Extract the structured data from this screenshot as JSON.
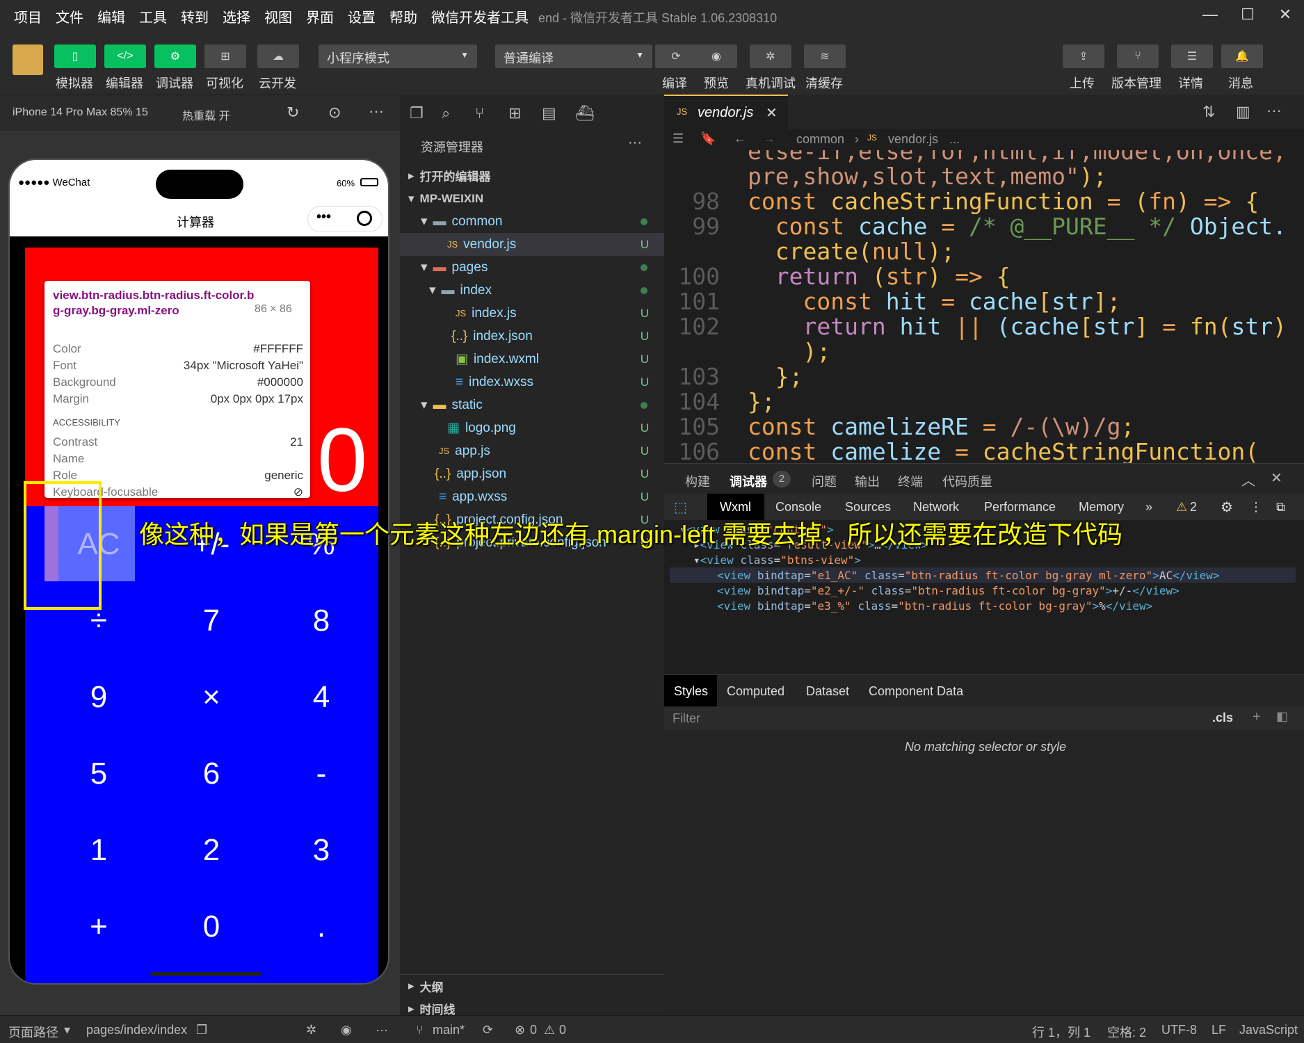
{
  "menu": [
    "项目",
    "文件",
    "编辑",
    "工具",
    "转到",
    "选择",
    "视图",
    "界面",
    "设置",
    "帮助",
    "微信开发者工具"
  ],
  "window_title": "end - 微信开发者工具 Stable 1.06.2308310",
  "toolbar": {
    "simulator": "模拟器",
    "editor": "编辑器",
    "debugger": "调试器",
    "visual": "可视化",
    "cloud": "云开发",
    "mode": "小程序模式",
    "compile_mode": "普通编译",
    "compile": "编译",
    "preview": "预览",
    "real_debug": "真机调试",
    "clear_cache": "清缓存",
    "upload": "上传",
    "version": "版本管理",
    "details": "详情",
    "messages": "消息"
  },
  "sim": {
    "device": "iPhone 14 Pro Max 85% 15",
    "hotreload": "热重载 开",
    "carrier": "●●●●● WeChat",
    "battery": "60%",
    "nav_title": "计算器",
    "display": "0"
  },
  "tooltip": {
    "selector": "view.btn-radius.btn-radius.ft-color.bg-gray.bg-gray.ml-zero",
    "size": "86 × 86",
    "color_label": "Color",
    "color_value": "#FFFFFF",
    "font_label": "Font",
    "font_value": "34px \"Microsoft YaHei\"",
    "bg_label": "Background",
    "bg_value": "#000000",
    "margin_label": "Margin",
    "margin_value": "0px 0px 0px 17px",
    "access": "ACCESSIBILITY",
    "contrast_label": "Contrast",
    "contrast_value": "21",
    "name_label": "Name",
    "role_label": "Role",
    "role_value": "generic",
    "kbd_label": "Keyboard-focusable"
  },
  "keys": [
    [
      "AC",
      "+/-",
      "%"
    ],
    [
      "÷",
      "7",
      "8"
    ],
    [
      "9",
      "×",
      "4"
    ],
    [
      "5",
      "6",
      "-"
    ],
    [
      "1",
      "2",
      "3"
    ],
    [
      "+",
      "0",
      "."
    ]
  ],
  "explorer": {
    "title": "资源管理器",
    "open_editors": "打开的编辑器",
    "root": "MP-WEIXIN",
    "items": [
      {
        "name": "common",
        "status": ""
      },
      {
        "name": "vendor.js",
        "status": "U"
      },
      {
        "name": "pages",
        "status": ""
      },
      {
        "name": "index",
        "status": ""
      },
      {
        "name": "index.js",
        "status": "U"
      },
      {
        "name": "index.json",
        "status": "U"
      },
      {
        "name": "index.wxml",
        "status": "U"
      },
      {
        "name": "index.wxss",
        "status": "U"
      },
      {
        "name": "static",
        "status": ""
      },
      {
        "name": "logo.png",
        "status": "U"
      },
      {
        "name": "app.js",
        "status": "U"
      },
      {
        "name": "app.json",
        "status": "U"
      },
      {
        "name": "app.wxss",
        "status": "U"
      },
      {
        "name": "project.config.json",
        "status": "U"
      },
      {
        "name": "project.private.config.json",
        "status": "U"
      }
    ],
    "outline": "大纲",
    "timeline": "时间线"
  },
  "editor": {
    "tab": "vendor.js",
    "crumb1": "common",
    "crumb2": "vendor.js",
    "crumb3": "..."
  },
  "code": {
    "ln98": "98",
    "ln99": "99",
    "ln100": "100",
    "ln101": "101",
    "ln102": "102",
    "ln103": "103",
    "ln104": "104",
    "ln105": "105",
    "ln106": "106"
  },
  "devtools": {
    "tabs": [
      "构建",
      "调试器",
      "问题",
      "输出",
      "终端",
      "代码质量"
    ],
    "badge": "2",
    "panels": [
      "Wxml",
      "Console",
      "Sources",
      "Network",
      "Performance",
      "Memory"
    ],
    "warn": "2",
    "style_tabs": [
      "Styles",
      "Computed",
      "Dataset",
      "Component Data"
    ],
    "filter": "Filter",
    "cls": ".cls",
    "empty": "No matching selector or style"
  },
  "statusbar": {
    "path_label": "页面路径",
    "path": "pages/index/index",
    "branch": "main*",
    "errors": "0",
    "warnings": "0",
    "pos": "行 1，列 1",
    "spaces": "空格: 2",
    "enc": "UTF-8",
    "eol": "LF",
    "lang": "JavaScript"
  },
  "subtitle": "像这种，如果是第一个元素这种左边还有 margin-left 需要去掉，所以还需要在改造下代码"
}
